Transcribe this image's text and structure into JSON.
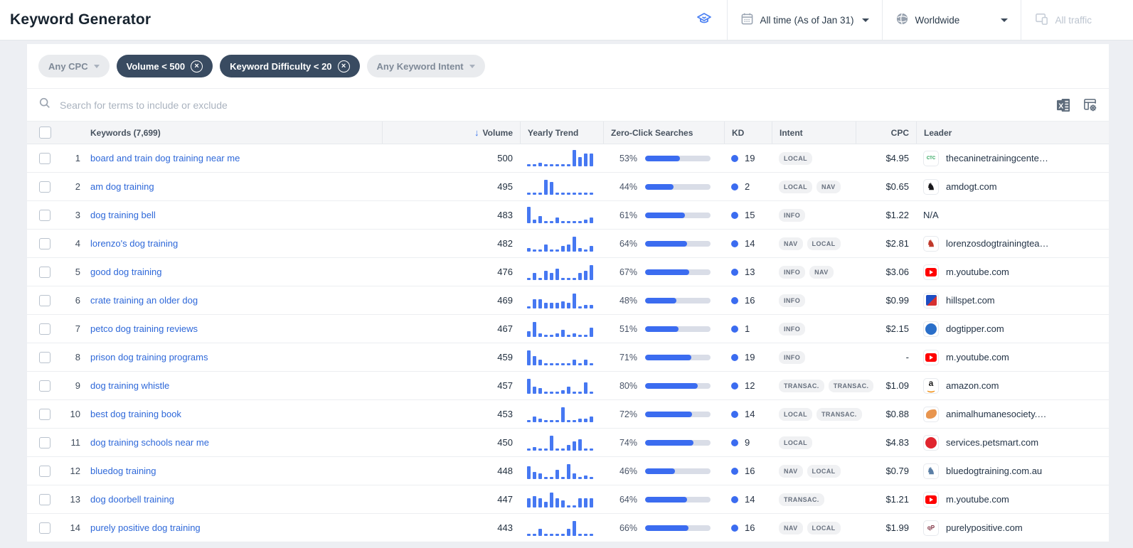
{
  "header": {
    "title": "Keyword Generator",
    "date_filter": "All time (As of Jan 31)",
    "region_filter": "Worldwide",
    "traffic_filter": "All traffic"
  },
  "filters": {
    "chips": [
      {
        "label": "Any CPC",
        "style": "inactive-dropdown"
      },
      {
        "label": "Volume < 500",
        "style": "active-removable"
      },
      {
        "label": "Keyword Difficulty < 20",
        "style": "active-removable"
      },
      {
        "label": "Any Keyword Intent",
        "style": "inactive-dropdown"
      }
    ]
  },
  "search": {
    "placeholder": "Search for terms to include or exclude"
  },
  "toolbar_icons": [
    "excel-export",
    "column-settings"
  ],
  "colors": {
    "accent_blue": "#3b6cf0",
    "link_blue": "#2e68d9",
    "trend_bar": "#4678f2",
    "chip_navy": "#394b61"
  },
  "table": {
    "columns": {
      "keywords": "Keywords (7,699)",
      "volume": "Volume",
      "trend": "Yearly Trend",
      "zero_click": "Zero-Click Searches",
      "kd": "KD",
      "intent": "Intent",
      "cpc": "CPC",
      "leader": "Leader"
    },
    "sort": {
      "column": "volume",
      "direction": "desc"
    },
    "rows": [
      {
        "num": 1,
        "keyword": "board and train dog training near me",
        "volume": 500,
        "trend": [
          1,
          1,
          2,
          1,
          1,
          1,
          1,
          1,
          9,
          5,
          7,
          7
        ],
        "zero_click": 53,
        "kd": 19,
        "intent": [
          "LOCAL"
        ],
        "cpc": "$4.95",
        "leader": "thecaninetrainingcente…",
        "favicon": {
          "kind": "text",
          "text": "CTC",
          "color": "#1e9e50",
          "fs": 6
        }
      },
      {
        "num": 2,
        "keyword": "am dog training",
        "volume": 495,
        "trend": [
          1,
          1,
          1,
          8,
          7,
          1,
          1,
          1,
          1,
          1,
          1,
          1
        ],
        "zero_click": 44,
        "kd": 2,
        "intent": [
          "LOCAL",
          "NAV"
        ],
        "cpc": "$0.65",
        "leader": "amdogt.com",
        "favicon": {
          "kind": "text",
          "text": "♞",
          "color": "#18181b",
          "fs": 13
        }
      },
      {
        "num": 3,
        "keyword": "dog training bell",
        "volume": 483,
        "trend": [
          9,
          2,
          4,
          1,
          1,
          3,
          1,
          1,
          1,
          1,
          2,
          3
        ],
        "zero_click": 61,
        "kd": 15,
        "intent": [
          "INFO"
        ],
        "cpc": "$1.22",
        "leader": "N/A",
        "favicon": null
      },
      {
        "num": 4,
        "keyword": "lorenzo's dog training",
        "volume": 482,
        "trend": [
          2,
          1,
          1,
          4,
          1,
          1,
          3,
          4,
          8,
          2,
          1,
          3
        ],
        "zero_click": 64,
        "kd": 14,
        "intent": [
          "NAV",
          "LOCAL"
        ],
        "cpc": "$2.81",
        "leader": "lorenzosdogtrainingtea…",
        "favicon": {
          "kind": "text",
          "text": "♞",
          "color": "#c0392b",
          "fs": 13
        }
      },
      {
        "num": 5,
        "keyword": "good dog training",
        "volume": 476,
        "trend": [
          1,
          4,
          1,
          5,
          4,
          6,
          1,
          1,
          1,
          4,
          5,
          8
        ],
        "zero_click": 67,
        "kd": 13,
        "intent": [
          "INFO",
          "NAV"
        ],
        "cpc": "$3.06",
        "leader": "m.youtube.com",
        "favicon": {
          "kind": "youtube"
        }
      },
      {
        "num": 6,
        "keyword": "crate training an older dog",
        "volume": 469,
        "trend": [
          1,
          5,
          5,
          3,
          3,
          3,
          4,
          3,
          8,
          1,
          2,
          2
        ],
        "zero_click": 48,
        "kd": 16,
        "intent": [
          "INFO"
        ],
        "cpc": "$0.99",
        "leader": "hillspet.com",
        "favicon": {
          "kind": "split",
          "c1": "#1d4fc4",
          "c2": "#d63031"
        }
      },
      {
        "num": 7,
        "keyword": "petco dog training reviews",
        "volume": 467,
        "trend": [
          3,
          8,
          2,
          1,
          1,
          2,
          4,
          1,
          2,
          1,
          1,
          5
        ],
        "zero_click": 51,
        "kd": 1,
        "intent": [
          "INFO"
        ],
        "cpc": "$2.15",
        "leader": "dogtipper.com",
        "favicon": {
          "kind": "circle",
          "bg": "#2a6fc9"
        }
      },
      {
        "num": 8,
        "keyword": "prison dog training programs",
        "volume": 459,
        "trend": [
          8,
          5,
          3,
          1,
          1,
          1,
          1,
          1,
          3,
          1,
          3,
          1
        ],
        "zero_click": 71,
        "kd": 19,
        "intent": [
          "INFO"
        ],
        "cpc": "-",
        "leader": "m.youtube.com",
        "favicon": {
          "kind": "youtube"
        }
      },
      {
        "num": 9,
        "keyword": "dog training whistle",
        "volume": 457,
        "trend": [
          8,
          4,
          3,
          1,
          1,
          1,
          2,
          4,
          1,
          1,
          6,
          1
        ],
        "zero_click": 80,
        "kd": 12,
        "intent": [
          "TRANSAC.",
          "TRANSAC."
        ],
        "cpc": "$1.09",
        "leader": "amazon.com",
        "favicon": {
          "kind": "amazon"
        }
      },
      {
        "num": 10,
        "keyword": "best dog training book",
        "volume": 453,
        "trend": [
          1,
          3,
          2,
          1,
          1,
          1,
          8,
          1,
          1,
          2,
          2,
          3
        ],
        "zero_click": 72,
        "kd": 14,
        "intent": [
          "LOCAL",
          "TRANSAC."
        ],
        "cpc": "$0.88",
        "leader": "animalhumanesociety.…",
        "favicon": {
          "kind": "blob",
          "bg": "#e8954f"
        }
      },
      {
        "num": 11,
        "keyword": "dog training schools near me",
        "volume": 450,
        "trend": [
          1,
          2,
          1,
          1,
          8,
          1,
          1,
          3,
          5,
          6,
          1,
          1
        ],
        "zero_click": 74,
        "kd": 9,
        "intent": [
          "LOCAL"
        ],
        "cpc": "$4.83",
        "leader": "services.petsmart.com",
        "favicon": {
          "kind": "circle",
          "bg": "#e0252e"
        }
      },
      {
        "num": 12,
        "keyword": "bluedog training",
        "volume": 448,
        "trend": [
          7,
          4,
          3,
          1,
          1,
          5,
          1,
          8,
          3,
          1,
          2,
          1
        ],
        "zero_click": 46,
        "kd": 16,
        "intent": [
          "NAV",
          "LOCAL"
        ],
        "cpc": "$0.79",
        "leader": "bluedogtraining.com.au",
        "favicon": {
          "kind": "text",
          "text": "♞",
          "color": "#5b7fa6",
          "fs": 13
        }
      },
      {
        "num": 13,
        "keyword": "dog doorbell training",
        "volume": 447,
        "trend": [
          5,
          6,
          5,
          3,
          8,
          5,
          4,
          1,
          1,
          5,
          5,
          5
        ],
        "zero_click": 64,
        "kd": 14,
        "intent": [
          "TRANSAC."
        ],
        "cpc": "$1.21",
        "leader": "m.youtube.com",
        "favicon": {
          "kind": "youtube"
        }
      },
      {
        "num": 14,
        "keyword": "purely positive dog training",
        "volume": 443,
        "trend": [
          1,
          1,
          4,
          1,
          1,
          1,
          1,
          4,
          8,
          1,
          1,
          1
        ],
        "zero_click": 66,
        "kd": 16,
        "intent": [
          "NAV",
          "LOCAL"
        ],
        "cpc": "$1.99",
        "leader": "purelypositive.com",
        "favicon": {
          "kind": "text",
          "text": "qP",
          "color": "#7c2d3e",
          "fs": 8
        }
      }
    ]
  }
}
